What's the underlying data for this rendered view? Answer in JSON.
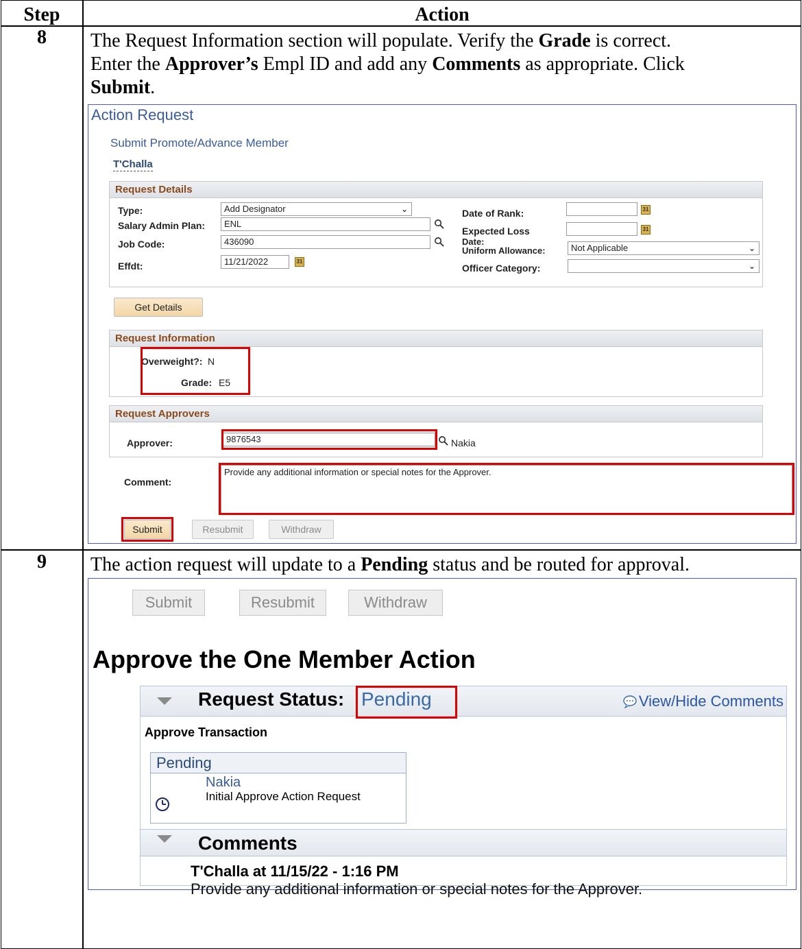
{
  "table": {
    "header_step": "Step",
    "header_action": "Action"
  },
  "step8": {
    "number": "8",
    "line1_a": "The Request Information section will populate. Verify the ",
    "line1_b": "Grade",
    "line1_c": " is correct.",
    "line2_a": "Enter the ",
    "line2_b": "Approver’s",
    "line2_c": " Empl ID and add any ",
    "line2_d": "Comments",
    "line2_e": " as appropriate. Click",
    "line3_b": "Submit",
    "line3_c": "."
  },
  "shot1": {
    "title": "Action Request",
    "subtitle": "Submit Promote/Advance Member",
    "member_name": "T'Challa",
    "details": {
      "header": "Request Details",
      "type_label": "Type:",
      "type_value": "Add Designator",
      "sal_plan_label": "Salary Admin Plan:",
      "sal_plan_value": "ENL",
      "job_code_label": "Job Code:",
      "job_code_value": "436090",
      "effdt_label": "Effdt:",
      "effdt_value": "11/21/2022",
      "date_of_rank_label": "Date of Rank:",
      "expected_loss_label": "Expected Loss",
      "date_label": "Date:",
      "uniform_label": "Uniform Allowance:",
      "uniform_value": "Not Applicable",
      "officer_cat_label": "Officer Category:"
    },
    "get_details_button": "Get Details",
    "info": {
      "header": "Request Information",
      "overweight_label": "Overweight?:",
      "overweight_value": "N",
      "grade_label": "Grade:",
      "grade_value": "E5"
    },
    "approvers": {
      "header": "Request Approvers",
      "approver_label": "Approver:",
      "approver_value": "9876543",
      "approver_name": "Nakia"
    },
    "comment_label": "Comment:",
    "comment_value": "Provide any additional information or special notes for the Approver.",
    "submit_button": "Submit",
    "resubmit_button": "Resubmit",
    "withdraw_button": "Withdraw"
  },
  "step9": {
    "number": "9",
    "text_a": "The action request will update to a ",
    "text_b": "Pending",
    "text_c": " status and be routed for approval."
  },
  "shot2": {
    "submit_button": "Submit",
    "resubmit_button": "Resubmit",
    "withdraw_button": "Withdraw",
    "page_title": "Approve the One Member Action",
    "status_label": "Request Status:",
    "status_value": "Pending",
    "view_hide_comments": "View/Hide Comments",
    "approve_transaction": "Approve Transaction",
    "pending_header": "Pending",
    "approver_name": "Nakia",
    "approver_step": "Initial Approve Action Request",
    "comments_header": "Comments",
    "comment_author": "T'Challa",
    "comment_meta": " at 11/15/22 - 1:16 PM",
    "comment_text": "Provide any additional information or special notes for the Approver."
  },
  "colors": {
    "highlight_red": "#e00000",
    "link_blue": "#3a5c9c",
    "group_header": "#8a4a1c"
  }
}
